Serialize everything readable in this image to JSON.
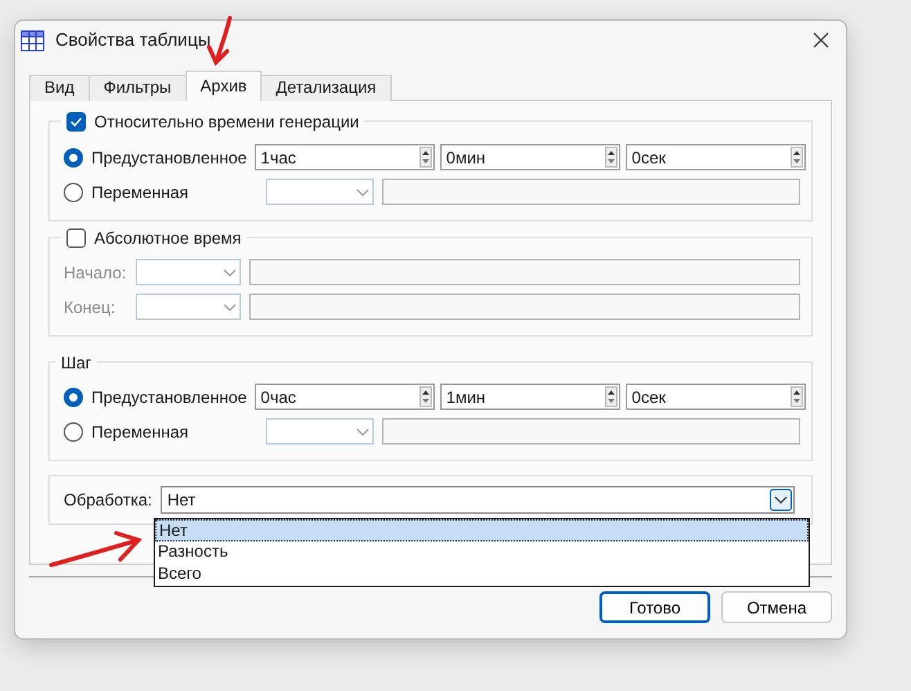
{
  "window": {
    "title": "Свойства таблицы"
  },
  "tabs": [
    {
      "label": "Вид",
      "selected": false
    },
    {
      "label": "Фильтры",
      "selected": false
    },
    {
      "label": "Архив",
      "selected": true
    },
    {
      "label": "Детализация",
      "selected": false
    }
  ],
  "relative_group": {
    "label": "Относительно времени генерации",
    "checked": true,
    "preset": {
      "label": "Предустановленное",
      "selected": true,
      "fields": [
        {
          "value": "1час"
        },
        {
          "value": "0мин"
        },
        {
          "value": "0сек"
        }
      ]
    },
    "variable": {
      "label": "Переменная",
      "selected": false
    }
  },
  "absolute_group": {
    "label": "Абсолютное время",
    "checked": false,
    "start_label": "Начало:",
    "end_label": "Конец:"
  },
  "step_group": {
    "title": "Шаг",
    "preset": {
      "label": "Предустановленное",
      "selected": true,
      "fields": [
        {
          "value": "0час"
        },
        {
          "value": "1мин"
        },
        {
          "value": "0сек"
        }
      ]
    },
    "variable": {
      "label": "Переменная",
      "selected": false
    }
  },
  "processing": {
    "label": "Обработка:",
    "value": "Нет",
    "expanded": true,
    "options": [
      {
        "label": "Нет",
        "selected": true
      },
      {
        "label": "Разность",
        "selected": false
      },
      {
        "label": "Всего",
        "selected": false
      }
    ]
  },
  "buttons": [
    {
      "label": "Готово",
      "kind": "default"
    },
    {
      "label": "Отмена",
      "kind": "normal"
    }
  ]
}
